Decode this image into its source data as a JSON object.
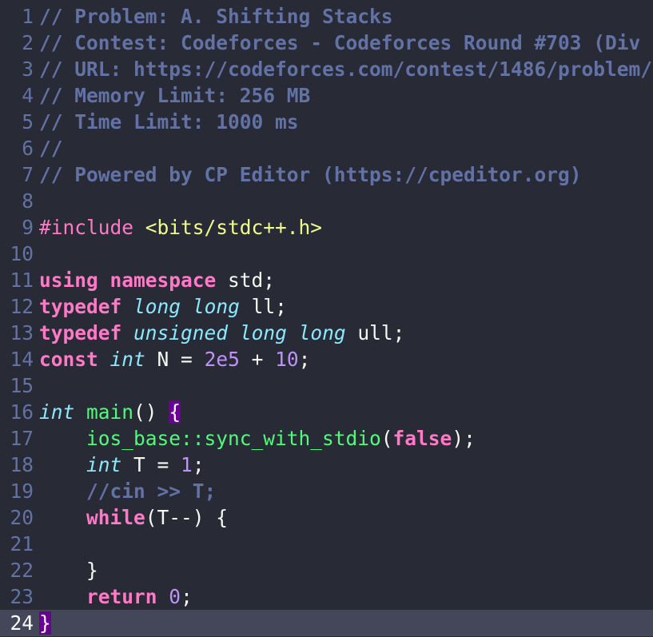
{
  "editor": {
    "lines": [
      {
        "num": "1",
        "segments": [
          {
            "t": "// Problem: A. Shifting Stacks",
            "c": "cm"
          }
        ]
      },
      {
        "num": "2",
        "segments": [
          {
            "t": "// Contest: Codeforces - Codeforces Round #703 (Div",
            "c": "cm"
          }
        ]
      },
      {
        "num": "3",
        "segments": [
          {
            "t": "// URL: https://codeforces.com/contest/1486/problem/",
            "c": "cm"
          }
        ]
      },
      {
        "num": "4",
        "segments": [
          {
            "t": "// Memory Limit: 256 MB",
            "c": "cm"
          }
        ]
      },
      {
        "num": "5",
        "segments": [
          {
            "t": "// Time Limit: 1000 ms",
            "c": "cm"
          }
        ]
      },
      {
        "num": "6",
        "segments": [
          {
            "t": "//",
            "c": "cm"
          }
        ]
      },
      {
        "num": "7",
        "segments": [
          {
            "t": "// Powered by CP Editor (https://cpeditor.org)",
            "c": "cm"
          }
        ]
      },
      {
        "num": "8",
        "segments": []
      },
      {
        "num": "9",
        "segments": [
          {
            "t": "#include ",
            "c": "pp"
          },
          {
            "t": "<bits/stdc++.h>",
            "c": "inc"
          }
        ]
      },
      {
        "num": "10",
        "segments": []
      },
      {
        "num": "11",
        "segments": [
          {
            "t": "using",
            "c": "kw"
          },
          {
            "t": " ",
            "c": "op"
          },
          {
            "t": "namespace",
            "c": "kw"
          },
          {
            "t": " std;",
            "c": "ident"
          }
        ]
      },
      {
        "num": "12",
        "segments": [
          {
            "t": "typedef",
            "c": "kw"
          },
          {
            "t": " ",
            "c": "op"
          },
          {
            "t": "long",
            "c": "ty"
          },
          {
            "t": " ",
            "c": "op"
          },
          {
            "t": "long",
            "c": "ty"
          },
          {
            "t": " ll;",
            "c": "ident"
          }
        ]
      },
      {
        "num": "13",
        "segments": [
          {
            "t": "typedef",
            "c": "kw"
          },
          {
            "t": " ",
            "c": "op"
          },
          {
            "t": "unsigned",
            "c": "ty"
          },
          {
            "t": " ",
            "c": "op"
          },
          {
            "t": "long",
            "c": "ty"
          },
          {
            "t": " ",
            "c": "op"
          },
          {
            "t": "long",
            "c": "ty"
          },
          {
            "t": " ull;",
            "c": "ident"
          }
        ]
      },
      {
        "num": "14",
        "segments": [
          {
            "t": "const",
            "c": "kw"
          },
          {
            "t": " ",
            "c": "op"
          },
          {
            "t": "int",
            "c": "ty"
          },
          {
            "t": " N = ",
            "c": "ident"
          },
          {
            "t": "2e5",
            "c": "num"
          },
          {
            "t": " + ",
            "c": "op"
          },
          {
            "t": "10",
            "c": "num"
          },
          {
            "t": ";",
            "c": "op"
          }
        ]
      },
      {
        "num": "15",
        "segments": []
      },
      {
        "num": "16",
        "segments": [
          {
            "t": "int",
            "c": "ty"
          },
          {
            "t": " ",
            "c": "op"
          },
          {
            "t": "main",
            "c": "fn"
          },
          {
            "t": "() ",
            "c": "op"
          },
          {
            "t": "{",
            "c": "brace-hl"
          }
        ]
      },
      {
        "num": "17",
        "segments": [
          {
            "t": "    ",
            "c": "op"
          },
          {
            "t": "ios_base::sync_with_stdio",
            "c": "fn"
          },
          {
            "t": "(",
            "c": "op"
          },
          {
            "t": "false",
            "c": "kw"
          },
          {
            "t": ");",
            "c": "op"
          }
        ]
      },
      {
        "num": "18",
        "segments": [
          {
            "t": "    ",
            "c": "op"
          },
          {
            "t": "int",
            "c": "ty"
          },
          {
            "t": " T = ",
            "c": "ident"
          },
          {
            "t": "1",
            "c": "num"
          },
          {
            "t": ";",
            "c": "op"
          }
        ]
      },
      {
        "num": "19",
        "segments": [
          {
            "t": "    //cin >> T;",
            "c": "cm"
          }
        ]
      },
      {
        "num": "20",
        "segments": [
          {
            "t": "    ",
            "c": "op"
          },
          {
            "t": "while",
            "c": "kw"
          },
          {
            "t": "(T--) {",
            "c": "ident"
          }
        ]
      },
      {
        "num": "21",
        "segments": []
      },
      {
        "num": "22",
        "segments": [
          {
            "t": "    }",
            "c": "op"
          }
        ]
      },
      {
        "num": "23",
        "segments": [
          {
            "t": "    ",
            "c": "op"
          },
          {
            "t": "return",
            "c": "kw"
          },
          {
            "t": " ",
            "c": "op"
          },
          {
            "t": "0",
            "c": "num"
          },
          {
            "t": ";",
            "c": "op"
          }
        ]
      },
      {
        "num": "24",
        "segments": [
          {
            "t": "}",
            "c": "brace-hl"
          }
        ],
        "current": true
      }
    ]
  }
}
